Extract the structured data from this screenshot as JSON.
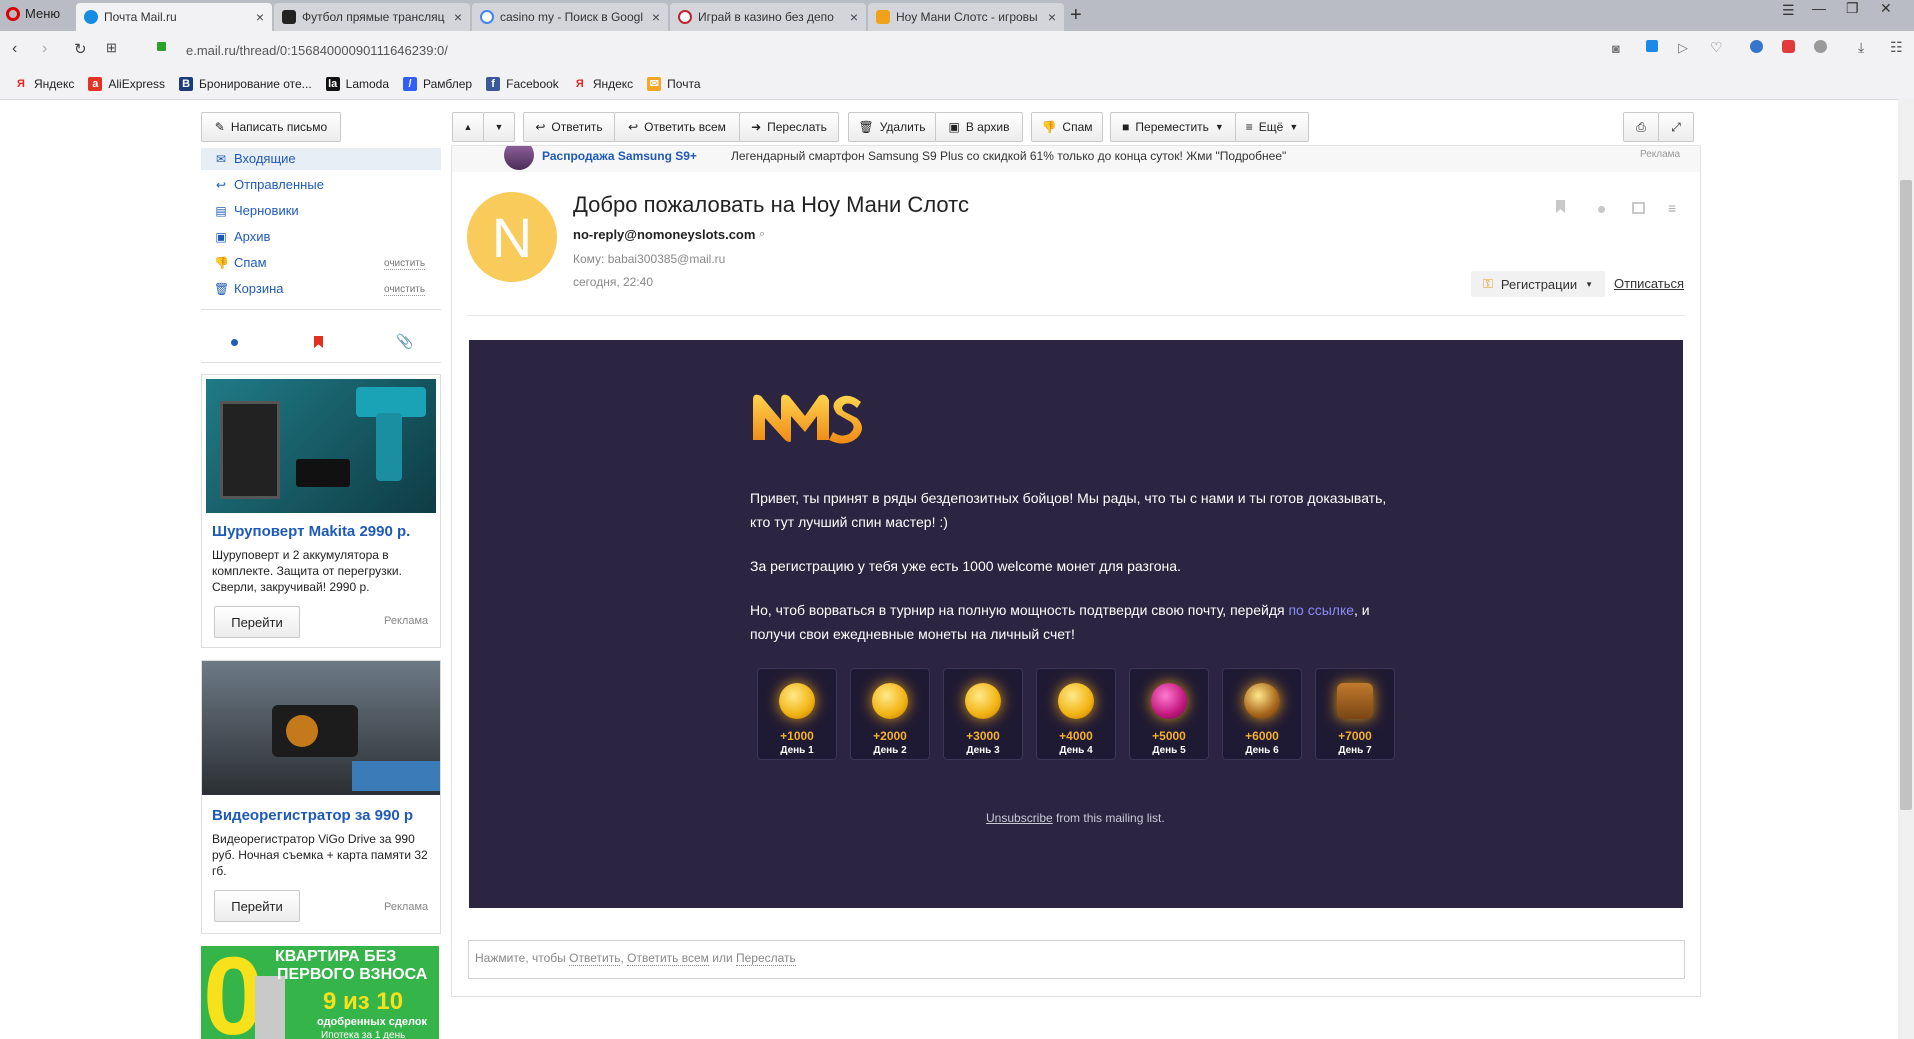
{
  "browser": {
    "menu_label": "Меню",
    "tabs": [
      {
        "title": "Почта Mail.ru",
        "active": true
      },
      {
        "title": "Футбол прямые трансляц"
      },
      {
        "title": "casino my - Поиск в Googl"
      },
      {
        "title": "Играй в казино без депо"
      },
      {
        "title": "Ноу Мани Слотс - игровы"
      }
    ],
    "new_tab": "+",
    "url": "e.mail.ru/thread/0:15684000090111646239:0/",
    "bookmarks": [
      "Яндекс",
      "AliExpress",
      "Бронирование оте...",
      "Lamoda",
      "Рамблер",
      "Facebook",
      "Яндекс",
      "Почта"
    ]
  },
  "toolbar": {
    "compose": "Написать письмо",
    "reply": "Ответить",
    "reply_all": "Ответить всем",
    "forward": "Переслать",
    "delete": "Удалить",
    "archive": "В архив",
    "spam": "Спам",
    "move": "Переместить",
    "more": "Ещё"
  },
  "sidebar": {
    "folders": [
      {
        "label": "Входящие",
        "icon": "inbox-icon"
      },
      {
        "label": "Отправленные",
        "icon": "sent-icon"
      },
      {
        "label": "Черновики",
        "icon": "drafts-icon"
      },
      {
        "label": "Архив",
        "icon": "archive-icon"
      },
      {
        "label": "Спам",
        "icon": "spam-icon",
        "action": "очистить"
      },
      {
        "label": "Корзина",
        "icon": "trash-icon",
        "action": "очистить"
      }
    ],
    "ads": [
      {
        "title": "Шуруповерт Makita 2990 р.",
        "text": "Шуруповерт и 2 аккумулятора в комплекте. Защита от перегрузки. Сверли, закручивай! 2990 р.",
        "button": "Перейти",
        "label": "Реклама"
      },
      {
        "title": "Видеорегистратор за 990 р",
        "text": "Видеорегистратор ViGo Drive за 990 руб. Ночная съемка + карта памяти 32 гб.",
        "button": "Перейти",
        "label": "Реклама"
      }
    ],
    "banner": {
      "line1": "КВАРТИРА БЕЗ",
      "line2": "ПЕРВОГО ВЗНОСА",
      "line3": "9 из 10",
      "line4": "одобренных сделок",
      "line5": "Ипотека за 1 день"
    }
  },
  "promo": {
    "title": "Распродажа Samsung S9+",
    "text": "Легендарный смартфон Samsung S9 Plus со скидкой 61% только до конца суток! Жми \"Подробнее\"",
    "label": "Реклама"
  },
  "message": {
    "avatar_letter": "N",
    "subject": "Добро пожаловать на Ноу Мани Слотс",
    "from": "no-reply@nomoneyslots.com",
    "to_label": "Кому:",
    "to": "babai300385@mail.ru",
    "date": "сегодня, 22:40",
    "category": "Регистрации",
    "unsubscribe": "Отписаться"
  },
  "email_body": {
    "logo": "NMS",
    "p1": "Привет, ты принят в ряды бездепозитных бойцов! Мы рады, что ты с нами и ты готов доказывать, кто тут лучший спин мастер! :)",
    "p2": "За регистрацию у тебя уже есть 1000 welcome монет для разгона.",
    "p3_before": "Но, чтоб ворваться в турнир на полную мощность подтверди свою почту, перейдя ",
    "p3_link": "по ссылке",
    "p3_after": ", и получи свои ежедневные монеты на личный счет!",
    "days": [
      {
        "amount": "+1000",
        "label": "День 1"
      },
      {
        "amount": "+2000",
        "label": "День 2"
      },
      {
        "amount": "+3000",
        "label": "День 3"
      },
      {
        "amount": "+4000",
        "label": "День 4"
      },
      {
        "amount": "+5000",
        "label": "День 5"
      },
      {
        "amount": "+6000",
        "label": "День 6"
      },
      {
        "amount": "+7000",
        "label": "День 7"
      }
    ],
    "unsub_link": "Unsubscribe",
    "unsub_rest": " from this mailing list."
  },
  "quick_reply": {
    "prefix": "Нажмите, чтобы ",
    "reply": "Ответить",
    "sep1": ", ",
    "reply_all": "Ответить всем",
    "sep2": " или ",
    "forward": "Переслать"
  }
}
